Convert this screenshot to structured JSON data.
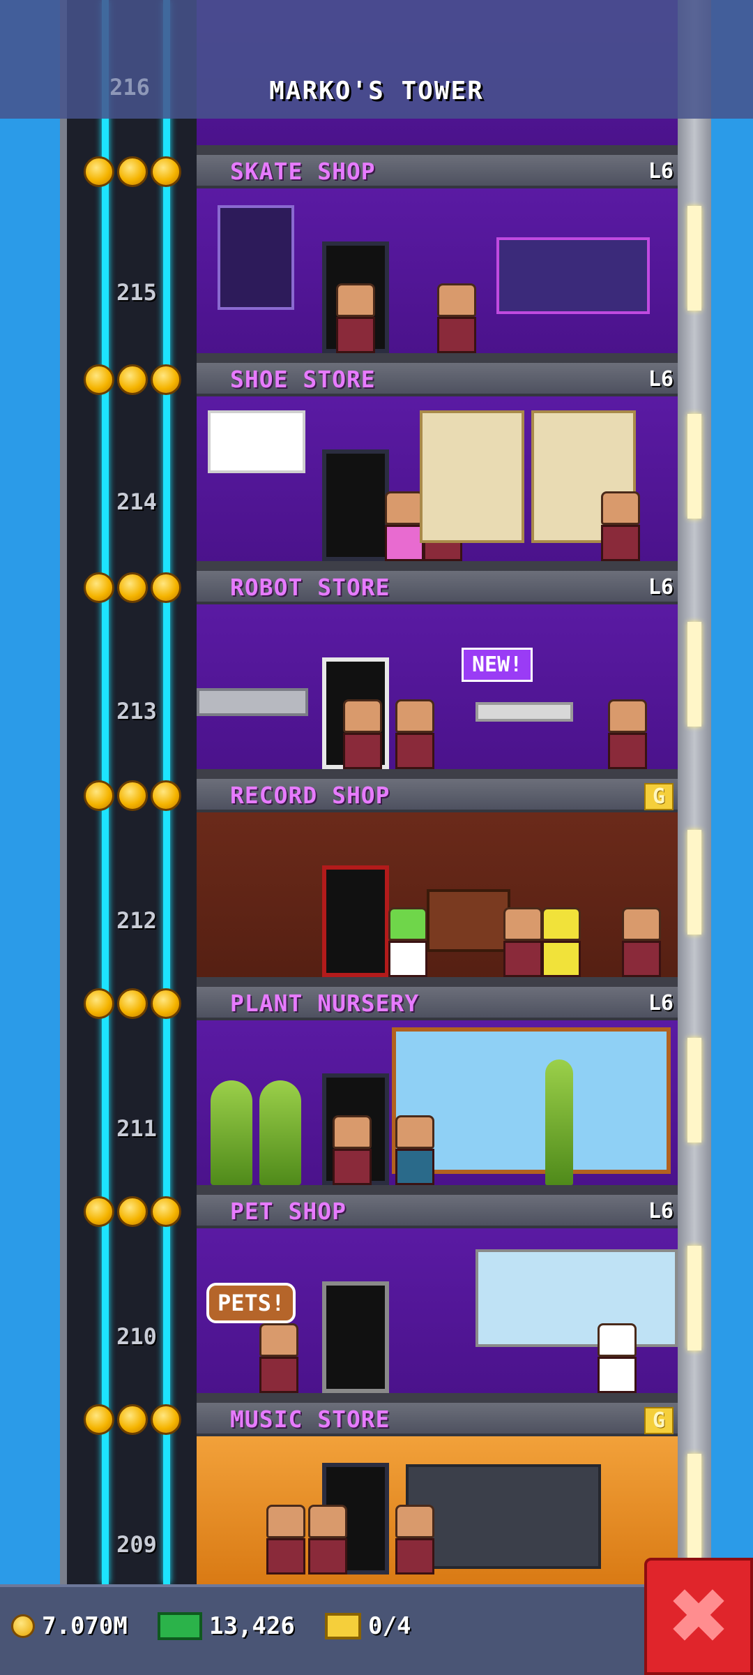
{
  "header": {
    "title": "MARKO'S TOWER",
    "top_floor_number": "216"
  },
  "floors": [
    {
      "number": "215",
      "name": "SKATE SHOP",
      "level": "L6",
      "level_style": "plain",
      "room": "purple"
    },
    {
      "number": "214",
      "name": "SHOE STORE",
      "level": "L6",
      "level_style": "plain",
      "room": "purple"
    },
    {
      "number": "213",
      "name": "ROBOT STORE",
      "level": "L6",
      "level_style": "plain",
      "room": "purple",
      "badge": "NEW!"
    },
    {
      "number": "212",
      "name": "RECORD SHOP",
      "level": "G",
      "level_style": "gold",
      "room": "brown"
    },
    {
      "number": "211",
      "name": "PLANT NURSERY",
      "level": "L6",
      "level_style": "plain",
      "room": "purple"
    },
    {
      "number": "210",
      "name": "PET SHOP",
      "level": "L6",
      "level_style": "plain",
      "room": "purple",
      "sign": "PETS!"
    },
    {
      "number": "209",
      "name": "MUSIC STORE",
      "level": "G",
      "level_style": "gold",
      "room": "orange"
    }
  ],
  "status": {
    "coins": "7.070M",
    "bux": "13,426",
    "tickets": "0/4"
  },
  "icons": {
    "coin": "coin-icon",
    "bux": "bux-icon",
    "ticket": "ticket-icon",
    "close": "close-icon",
    "star": "star-icon"
  },
  "colors": {
    "sky": "#2b9be8",
    "floor_name": "#e77bff",
    "cable": "#1de4ff",
    "close_button": "#e0252b"
  }
}
